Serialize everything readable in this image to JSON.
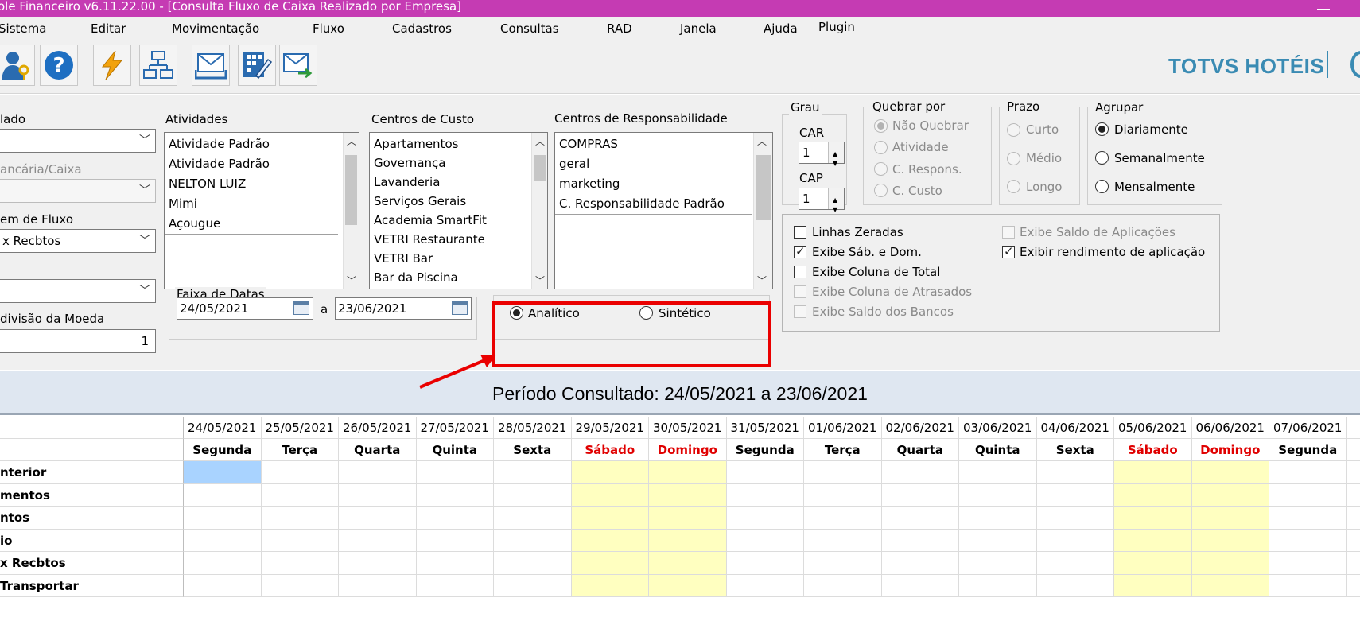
{
  "window": {
    "title": "ole Financeiro v6.11.22.00 - [Consulta Fluxo de Caixa Realizado por Empresa]"
  },
  "menu": [
    "Sistema",
    "Editar",
    "Movimentação",
    "Fluxo",
    "Cadastros",
    "Consultas",
    "RAD",
    "Janela",
    "Ajuda",
    "Plugin"
  ],
  "toolbar": {
    "buttons": [
      "user-key-icon",
      "help-icon",
      "lightning-icon",
      "flowchart-icon",
      "mail-tray-icon",
      "calculator-edit-icon",
      "mail-forward-icon"
    ],
    "brand": "TOTVS HOTÉIS"
  },
  "filters": {
    "left_labels": {
      "l1": "lado",
      "l2": "ancária/Caixa",
      "l3": "em de Fluxo",
      "l4": "divisão da Moeda"
    },
    "combo_fluxo_value": "x Recbtos",
    "moeda_value": "1",
    "atividades": {
      "label": "Atividades",
      "items": [
        "Atividade Padrão",
        "Atividade Padrão",
        "NELTON LUIZ",
        "Mimi",
        "Açougue"
      ]
    },
    "centros_custo": {
      "label": "Centros de Custo",
      "items": [
        "Apartamentos",
        "Governança",
        "Lavanderia",
        "Serviços Gerais",
        "Academia SmartFit",
        "VETRI Restaurante",
        "VETRI Bar",
        "Bar da Piscina"
      ]
    },
    "centros_resp": {
      "label": "Centros de Responsabilidade",
      "items": [
        "COMPRAS",
        "geral",
        "marketing",
        "C. Responsabilidade Padrão"
      ]
    },
    "faixa_datas": {
      "label": "Faixa de Datas",
      "from": "24/05/2021",
      "sep": "a",
      "to": "23/06/2021"
    },
    "tipo": {
      "analitico": "Analítico",
      "sintetico": "Sintético",
      "selected": "Analítico"
    },
    "grau": {
      "label": "Grau",
      "car_label": "CAR",
      "car_value": "1",
      "cap_label": "CAP",
      "cap_value": "1"
    },
    "quebrar": {
      "label": "Quebrar por",
      "options": [
        "Não Quebrar",
        "Atividade",
        "C. Respons.",
        "C. Custo"
      ]
    },
    "prazo": {
      "label": "Prazo",
      "options": [
        "Curto",
        "Médio",
        "Longo"
      ]
    },
    "agrupar": {
      "label": "Agrupar",
      "options": [
        "Diariamente",
        "Semanalmente",
        "Mensalmente"
      ],
      "selected": "Diariamente"
    },
    "checks_left": [
      {
        "label": "Linhas Zeradas",
        "checked": false,
        "enabled": true
      },
      {
        "label": "Exibe Sáb. e Dom.",
        "checked": true,
        "enabled": true
      },
      {
        "label": "Exibe Coluna de Total",
        "checked": false,
        "enabled": true
      },
      {
        "label": "Exibe Coluna de Atrasados",
        "checked": false,
        "enabled": false
      },
      {
        "label": "Exibe Saldo dos Bancos",
        "checked": false,
        "enabled": false
      }
    ],
    "checks_right": [
      {
        "label": "Exibe Saldo de Aplicações",
        "checked": false,
        "enabled": false
      },
      {
        "label": "Exibir rendimento de aplicação",
        "checked": true,
        "enabled": true
      }
    ]
  },
  "period": "Período Consultado: 24/05/2021 a 23/06/2021",
  "grid": {
    "dates": [
      "24/05/2021",
      "25/05/2021",
      "26/05/2021",
      "27/05/2021",
      "28/05/2021",
      "29/05/2021",
      "30/05/2021",
      "31/05/2021",
      "01/06/2021",
      "02/06/2021",
      "03/06/2021",
      "04/06/2021",
      "05/06/2021",
      "06/06/2021",
      "07/06/2021",
      "0"
    ],
    "days": [
      "Segunda",
      "Terça",
      "Quarta",
      "Quinta",
      "Sexta",
      "Sábado",
      "Domingo",
      "Segunda",
      "Terça",
      "Quarta",
      "Quinta",
      "Sexta",
      "Sábado",
      "Domingo",
      "Segunda",
      "T"
    ],
    "weekend_cols": [
      5,
      6,
      12,
      13
    ],
    "rows": [
      "nterior",
      "mentos",
      "ntos",
      "io",
      "x Recbtos",
      "Transportar"
    ]
  },
  "colors": {
    "titlebar": "#c53bb3",
    "weekend": "#ffffc0",
    "selected_cell": "#a9d3ff",
    "weekend_text": "#e00000",
    "annotation": "#ea0000",
    "brand": "#3a8bb3"
  }
}
